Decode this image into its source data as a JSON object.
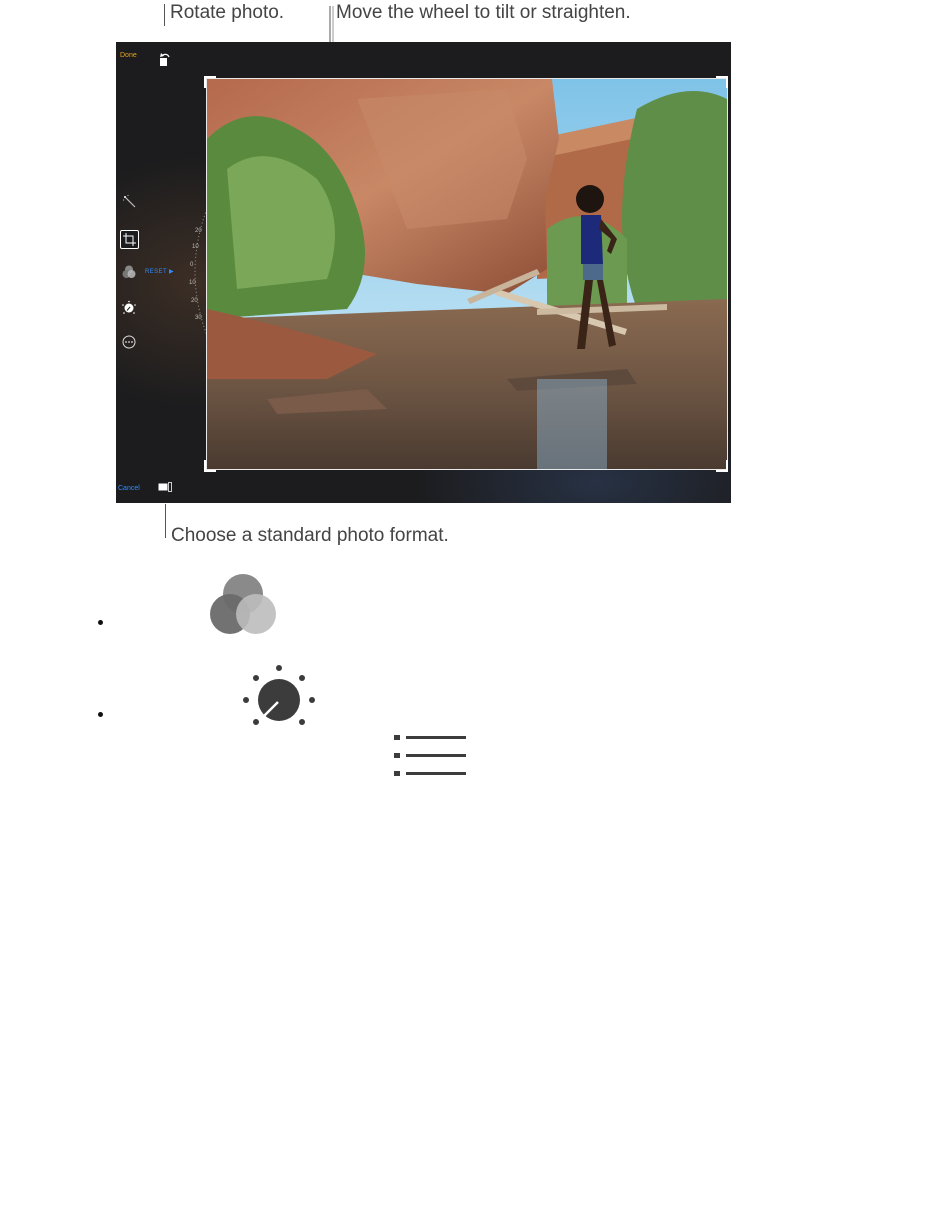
{
  "callouts": {
    "rotate": "Rotate photo.",
    "wheel": "Move the wheel to tilt or straighten.",
    "format": "Choose a standard photo format."
  },
  "editor": {
    "done_label": "Done",
    "cancel_label": "Cancel",
    "reset_label": "RESET ▶",
    "wheel_ticks": [
      "20",
      "10",
      "0",
      "10",
      "20",
      "30"
    ],
    "tools": [
      "magic-wand-icon",
      "crop-icon",
      "filters-icon",
      "adjust-dial-icon",
      "more-icon"
    ],
    "accent_done": "#e8a619",
    "accent_blue": "#2f8cff"
  },
  "icons": [
    "filters-icon",
    "adjust-dial-icon",
    "list-icon"
  ]
}
